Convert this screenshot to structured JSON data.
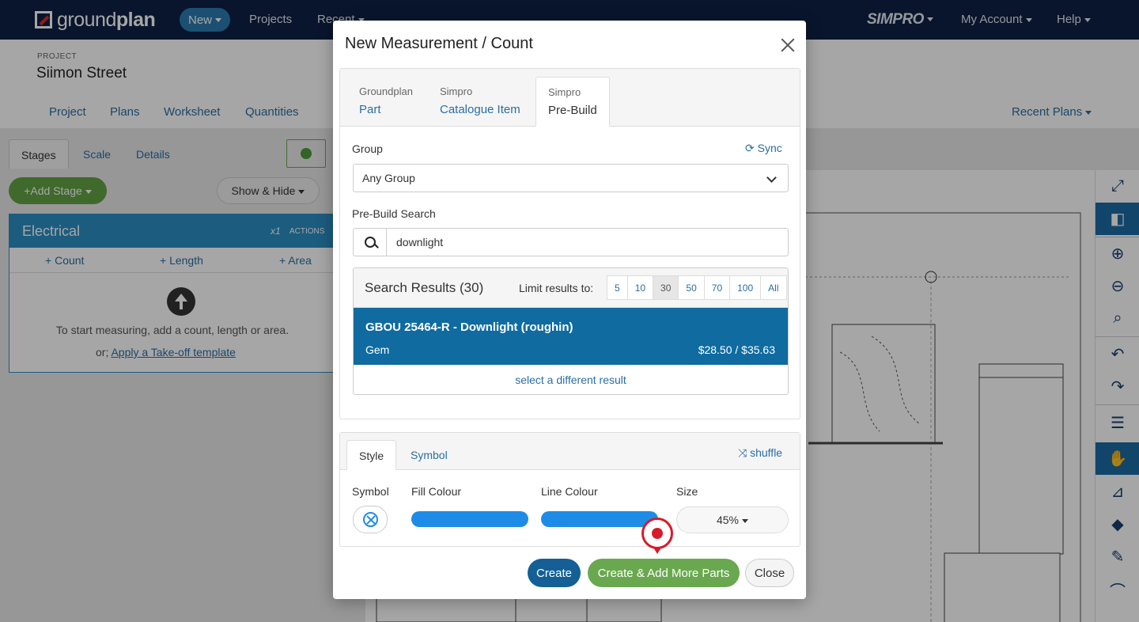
{
  "app": {
    "logo_part1": "ground",
    "logo_part2": "plan",
    "nav_new": "New",
    "nav_projects": "Projects",
    "nav_recent": "Recent",
    "nav_brand": "SIMPRO",
    "nav_account": "My Account",
    "nav_help": "Help"
  },
  "project": {
    "label": "PROJECT",
    "title": "Siimon Street",
    "tabs": [
      "Project",
      "Plans",
      "Worksheet",
      "Quantities"
    ],
    "recent_plans": "Recent Plans"
  },
  "sidebar": {
    "tabs": [
      "Stages",
      "Scale",
      "Details"
    ],
    "add_stage": "Add Stage",
    "show_hide": "Show & Hide",
    "panel_title": "Electrical",
    "multiplier": "x1",
    "actions": "ACTIONS",
    "tool_count": "Count",
    "tool_length": "Length",
    "tool_area": "Area",
    "empty_msg": "To start measuring, add a count, length or area.",
    "or_text": "or;",
    "template_link": "Apply a Take-off template"
  },
  "modal": {
    "title": "New Measurement / Count",
    "source_tabs": [
      {
        "top": "Groundplan",
        "bottom": "Part"
      },
      {
        "top": "Simpro",
        "bottom": "Catalogue Item"
      },
      {
        "top": "Simpro",
        "bottom": "Pre-Build"
      }
    ],
    "group_label": "Group",
    "sync_label": "Sync",
    "group_value": "Any Group",
    "search_label": "Pre-Build Search",
    "search_value": "downlight",
    "results_title": "Search Results (30)",
    "limit_label": "Limit results to:",
    "limit_options": [
      "5",
      "10",
      "30",
      "50",
      "70",
      "100",
      "All"
    ],
    "limit_selected": "30",
    "result": {
      "name": "GBOU 25464-R - Downlight (roughin)",
      "brand": "Gem",
      "price": "$28.50 / $35.63"
    },
    "select_different": "select a different result",
    "style_tabs": [
      "Style",
      "Symbol"
    ],
    "shuffle_label": "shuffle",
    "symbol_label": "Symbol",
    "fill_label": "Fill Colour",
    "line_label": "Line Colour",
    "size_label": "Size",
    "size_value": "45%",
    "fill_color": "#1e8ce6",
    "line_color": "#1e8ce6",
    "btn_create": "Create",
    "btn_more": "Create & Add More Parts",
    "btn_close": "Close"
  }
}
